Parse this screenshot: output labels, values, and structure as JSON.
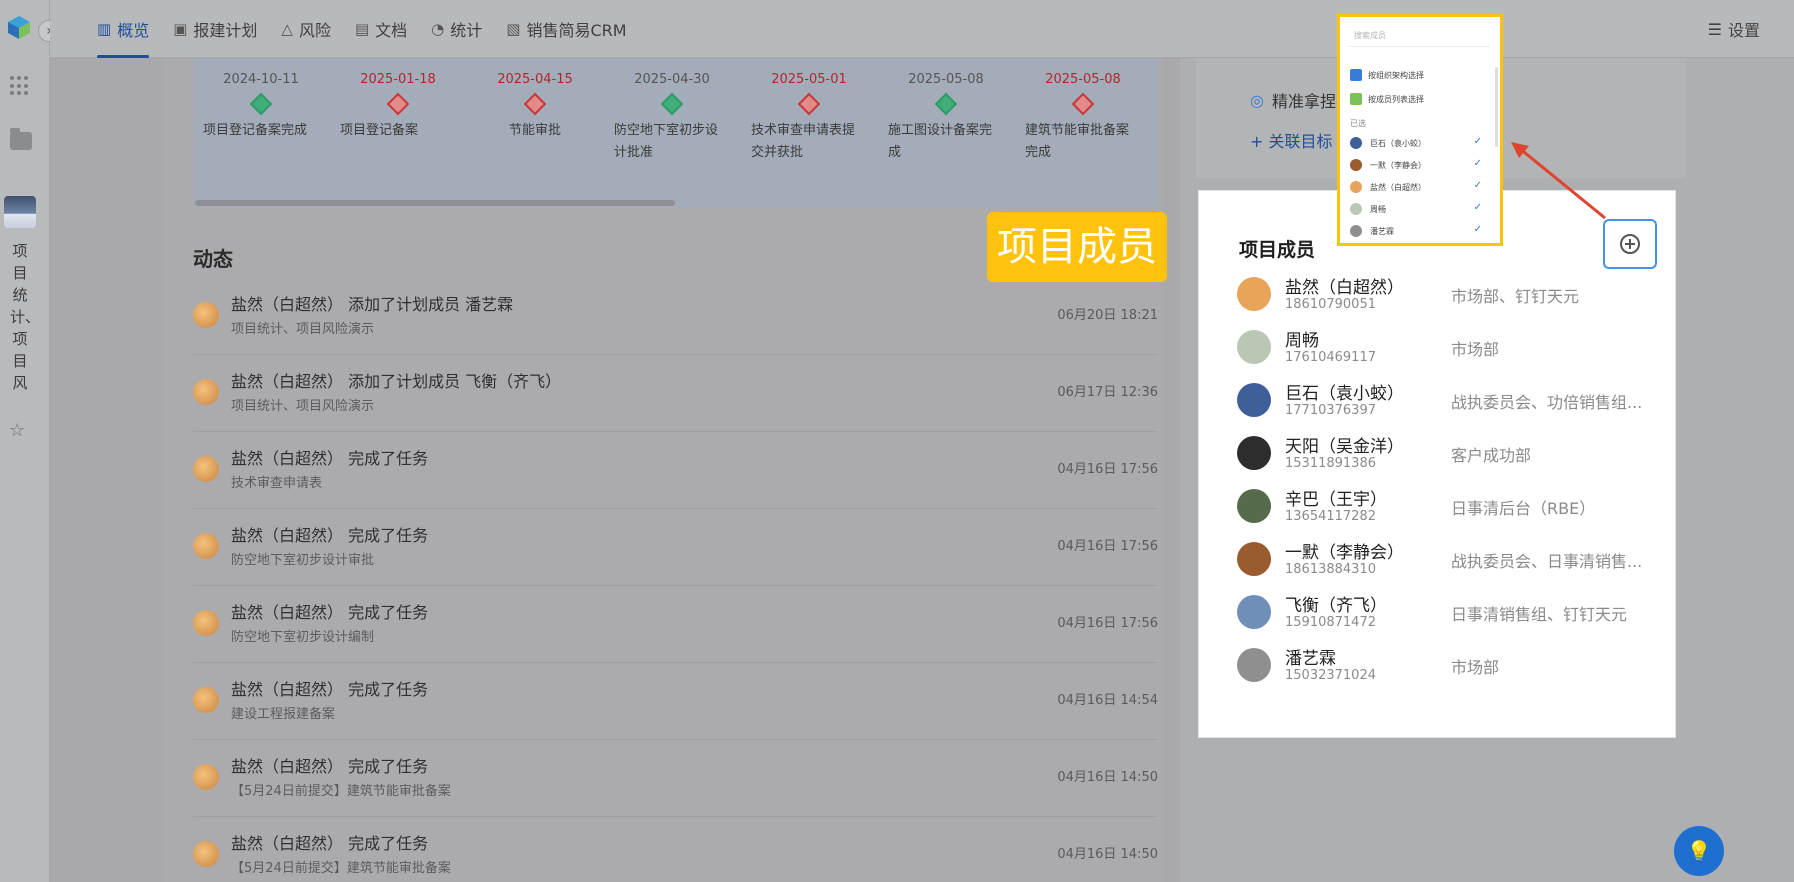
{
  "nav": {
    "items": [
      {
        "label": "概览",
        "icon": "overview-icon",
        "active": true
      },
      {
        "label": "报建计划",
        "icon": "plan-icon",
        "active": false
      },
      {
        "label": "风险",
        "icon": "warning-icon",
        "active": false
      },
      {
        "label": "文档",
        "icon": "document-icon",
        "active": false
      },
      {
        "label": "统计",
        "icon": "pie-chart-icon",
        "active": false
      },
      {
        "label": "销售简易CRM",
        "icon": "crm-icon",
        "active": false
      }
    ],
    "settings_label": "设置"
  },
  "sidebar": {
    "project_name": "项目统计、项目风"
  },
  "timeline": {
    "milestones": [
      {
        "date": "2024-10-11",
        "title": "项目登记备案完成",
        "status": "done"
      },
      {
        "date": "2025-01-18",
        "title": "项目登记备案",
        "status": "overdue"
      },
      {
        "date": "2025-04-15",
        "title": "节能审批",
        "status": "overdue"
      },
      {
        "date": "2025-04-30",
        "title": "防空地下室初步设计批准",
        "status": "done"
      },
      {
        "date": "2025-05-01",
        "title": "技术审查申请表提交并获批",
        "status": "overdue"
      },
      {
        "date": "2025-05-08",
        "title": "施工图设计备案完成",
        "status": "done"
      },
      {
        "date": "2025-05-08",
        "title": "建筑节能审批备案完成",
        "status": "overdue"
      }
    ]
  },
  "feed": {
    "title": "动态",
    "items": [
      {
        "text": "盐然（白超然） 添加了计划成员 潘艺霖",
        "sub": "项目统计、项目风险演示",
        "time": "06月20日 18:21"
      },
      {
        "text": "盐然（白超然） 添加了计划成员 飞衡（齐飞）",
        "sub": "项目统计、项目风险演示",
        "time": "06月17日 12:36"
      },
      {
        "text": "盐然（白超然） 完成了任务",
        "sub": "技术审查申请表",
        "time": "04月16日 17:56"
      },
      {
        "text": "盐然（白超然） 完成了任务",
        "sub": "防空地下室初步设计审批",
        "time": "04月16日 17:56"
      },
      {
        "text": "盐然（白超然） 完成了任务",
        "sub": "防空地下室初步设计编制",
        "time": "04月16日 17:56"
      },
      {
        "text": "盐然（白超然） 完成了任务",
        "sub": "建设工程报建备案",
        "time": "04月16日 14:54"
      },
      {
        "text": "盐然（白超然） 完成了任务",
        "sub": "【5月24日前提交】建筑节能审批备案",
        "time": "04月16日 14:50"
      },
      {
        "text": "盐然（白超然） 完成了任务",
        "sub": "【5月24日前提交】建筑节能审批备案",
        "time": "04月16日 14:50"
      }
    ]
  },
  "right": {
    "aim_label": "精准拿捏客",
    "link_goal": "+ 关联目标"
  },
  "members": {
    "title": "项目成员",
    "list": [
      {
        "name": "盐然（白超然）",
        "phone": "18610790051",
        "dept": "市场部、钉钉天元",
        "color": "#e8a55a"
      },
      {
        "name": "周畅",
        "phone": "17610469117",
        "dept": "市场部",
        "color": "#b9c7b4"
      },
      {
        "name": "巨石（袁小蛟）",
        "phone": "17710376397",
        "dept": "战执委员会、功倍销售组...",
        "color": "#3f5f9a"
      },
      {
        "name": "天阳（吴金洋）",
        "phone": "15311891386",
        "dept": "客户成功部",
        "color": "#2d2d2d"
      },
      {
        "name": "辛巴（王宇）",
        "phone": "13654117282",
        "dept": "日事清后台（RBE）",
        "color": "#556b4c"
      },
      {
        "name": "一默（李静会）",
        "phone": "18613884310",
        "dept": "战执委员会、日事清销售...",
        "color": "#9a5b2f"
      },
      {
        "name": "飞衡（齐飞）",
        "phone": "15910871472",
        "dept": "日事清销售组、钉钉天元",
        "color": "#6f8fb8"
      },
      {
        "name": "潘艺霖",
        "phone": "15032371024",
        "dept": "市场部",
        "color": "#8f8f8f"
      }
    ]
  },
  "annotation": {
    "tag": "项目成员"
  },
  "popup": {
    "search_placeholder": "搜索成员",
    "opt_org": "按组织架构选择",
    "opt_list": "按成员列表选择",
    "selected_label": "已选",
    "selected": [
      {
        "name": "巨石（袁小蛟）",
        "color": "#3f5f9a"
      },
      {
        "name": "一默（李静会）",
        "color": "#9a5b2f"
      },
      {
        "name": "盐然（白超然）",
        "color": "#e8a55a"
      },
      {
        "name": "周畅",
        "color": "#b9c7b4"
      },
      {
        "name": "潘艺霖",
        "color": "#8f8f8f"
      }
    ]
  }
}
